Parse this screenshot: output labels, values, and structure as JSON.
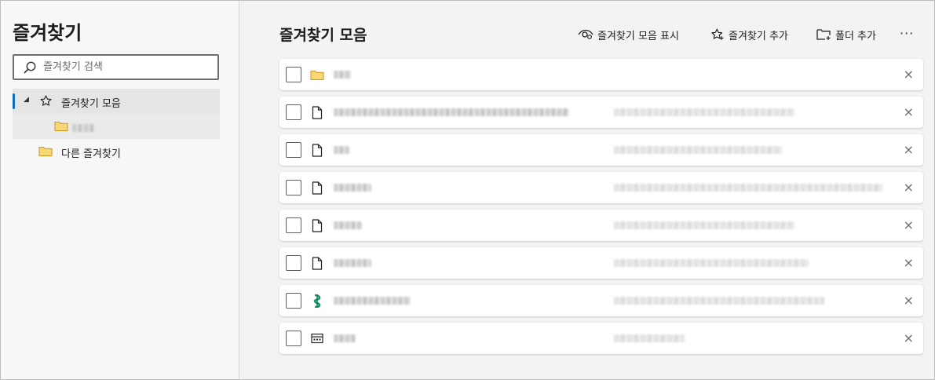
{
  "sidebar": {
    "title": "즐겨찾기",
    "search": {
      "placeholder": "즐겨찾기 검색",
      "value": ""
    },
    "tree": {
      "favorites_bar_label": "즐겨찾기 모음",
      "other_favorites_label": "다른 즐겨찾기"
    }
  },
  "main": {
    "title": "즐겨찾기 모음",
    "toolbar": {
      "show_bar_label": "즐겨찾기 모음 표시",
      "add_favorite_label": "즐겨찾기 추가",
      "add_folder_label": "폴더 추가",
      "more_label": "···"
    },
    "rows": [
      {
        "icon": "folder-icon"
      },
      {
        "icon": "page-icon"
      },
      {
        "icon": "page-icon"
      },
      {
        "icon": "page-icon"
      },
      {
        "icon": "page-icon"
      },
      {
        "icon": "page-icon"
      },
      {
        "icon": "site-logo-icon"
      },
      {
        "icon": "window-icon"
      }
    ],
    "close_label": "×"
  },
  "colors": {
    "accent": "#0f6cbd",
    "folder": "#f2c94c",
    "background": "#f3f3f3"
  }
}
